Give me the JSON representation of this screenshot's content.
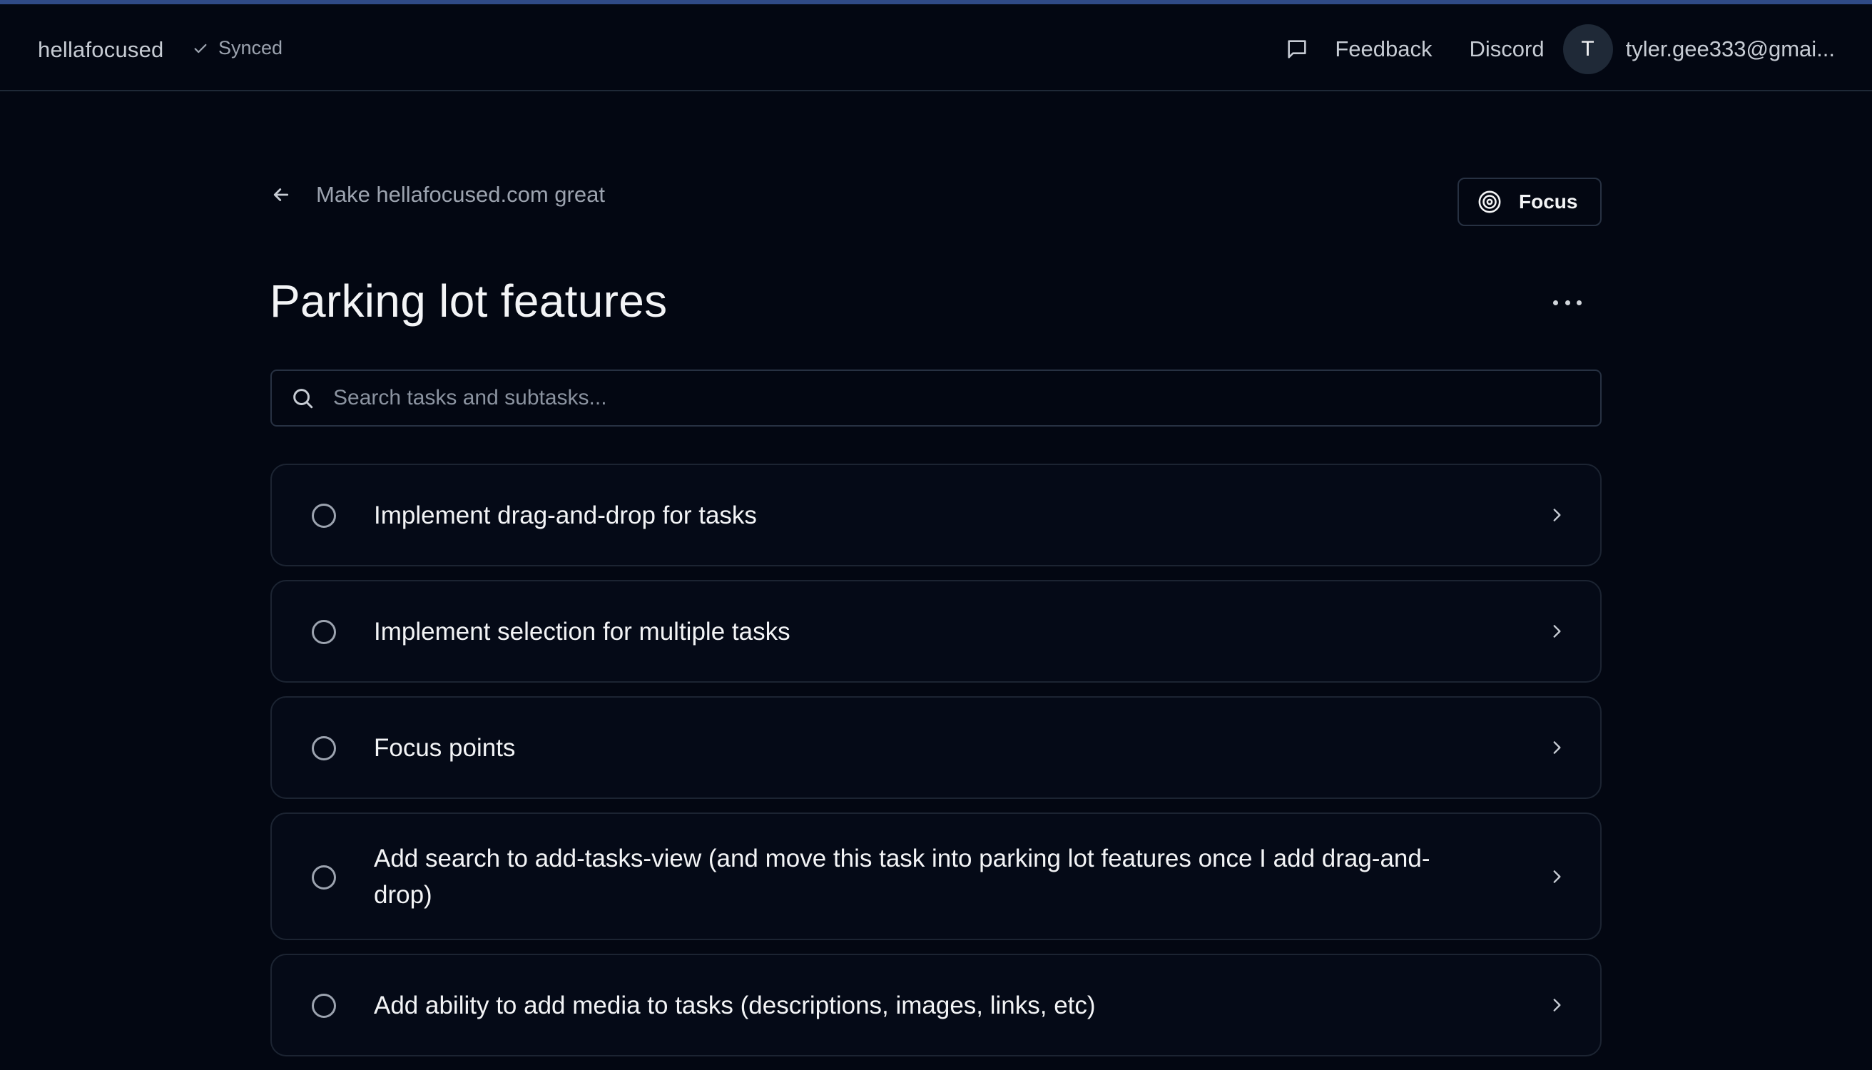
{
  "header": {
    "brand": "hellafocused",
    "sync_status": "Synced",
    "feedback_label": "Feedback",
    "discord_label": "Discord",
    "avatar_initial": "T",
    "user_email": "tyler.gee333@gmai..."
  },
  "breadcrumb": {
    "parent_label": "Make hellafocused.com great"
  },
  "focus_button": {
    "label": "Focus"
  },
  "page": {
    "title": "Parking lot features"
  },
  "search": {
    "placeholder": "Search tasks and subtasks...",
    "value": ""
  },
  "tasks": [
    {
      "label": "Implement drag-and-drop for tasks",
      "completed": false
    },
    {
      "label": "Implement selection for multiple tasks",
      "completed": false
    },
    {
      "label": "Focus points",
      "completed": false
    },
    {
      "label": "Add search to add-tasks-view (and move this task into parking lot features once I add drag-and-drop)",
      "completed": false
    },
    {
      "label": "Add ability to add media to tasks (descriptions, images, links, etc)",
      "completed": false
    }
  ],
  "colors": {
    "background": "#030712",
    "top_accent": "#2f4a86",
    "border": "#1c2432",
    "text_primary": "#f3f4f6",
    "text_muted": "#9ca3af"
  }
}
